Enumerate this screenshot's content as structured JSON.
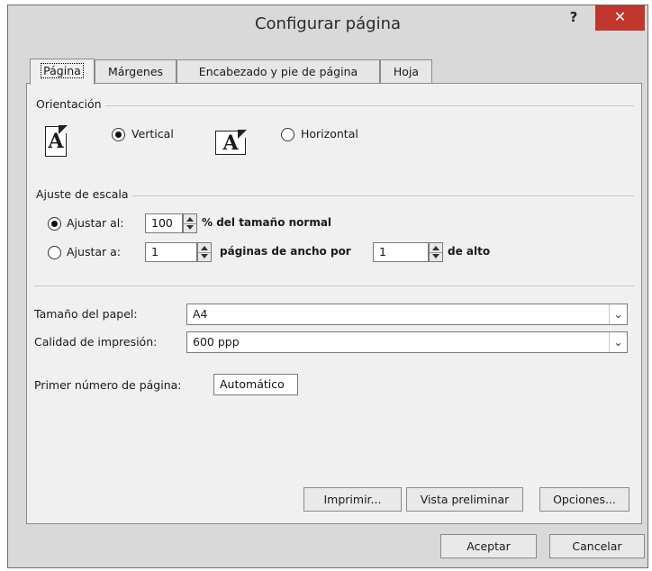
{
  "window": {
    "title": "Configurar página",
    "help_label": "?",
    "close_label": "✕"
  },
  "tabs": [
    {
      "label": "Página",
      "active": true
    },
    {
      "label": "Márgenes",
      "active": false
    },
    {
      "label": "Encabezado y pie de página",
      "active": false
    },
    {
      "label": "Hoja",
      "active": false
    }
  ],
  "orientation": {
    "group_label": "Orientación",
    "icon_letter": "A",
    "vertical_label": "Vertical",
    "horizontal_label": "Horizontal",
    "selected": "vertical"
  },
  "scaling": {
    "group_label": "Ajuste de escala",
    "adjust_to_label": "Ajustar al:",
    "adjust_to_value": "100",
    "adjust_to_suffix": "% del tamaño normal",
    "fit_to_label": "Ajustar a:",
    "fit_pages_wide": "1",
    "fit_middle": "páginas de ancho por",
    "fit_pages_tall": "1",
    "fit_suffix": "de alto",
    "selected": "adjust_to"
  },
  "paper": {
    "size_label": "Tamaño del papel:",
    "size_value": "A4",
    "quality_label": "Calidad de impresión:",
    "quality_value": "600 ppp",
    "first_page_label": "Primer número de página:",
    "first_page_value": "Automático"
  },
  "panel_buttons": {
    "print": "Imprimir...",
    "preview": "Vista preliminar",
    "options": "Opciones..."
  },
  "footer_buttons": {
    "ok": "Aceptar",
    "cancel": "Cancelar"
  },
  "colors": {
    "dialog_bg": "#d9d9d9",
    "panel_bg": "#f0f0f0",
    "close_button": "#c0362c"
  }
}
